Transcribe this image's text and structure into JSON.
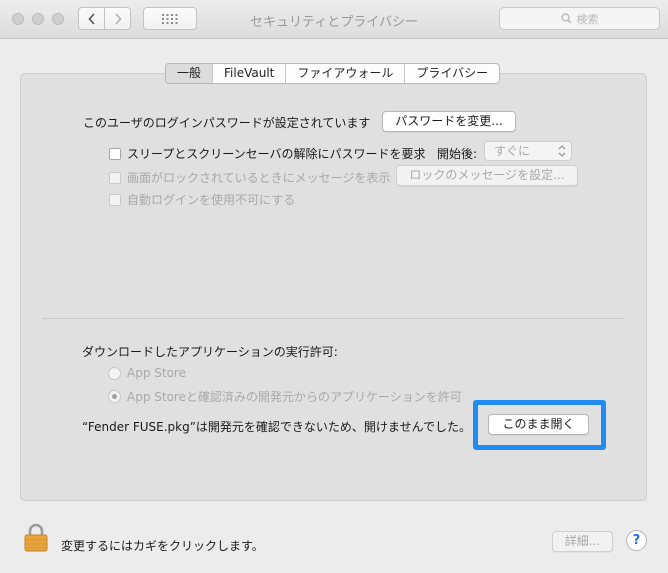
{
  "window": {
    "title": "セキュリティとプライバシー",
    "search_placeholder": "検索"
  },
  "tabs": [
    {
      "label": "一般",
      "selected": true
    },
    {
      "label": "FileVault",
      "selected": false
    },
    {
      "label": "ファイアウォール",
      "selected": false
    },
    {
      "label": "プライバシー",
      "selected": false
    }
  ],
  "general": {
    "password_set_text": "このユーザのログインパスワードが設定されています",
    "change_password_button": "パスワードを変更...",
    "require_password_label": "スリープとスクリーンセーバの解除にパスワードを要求",
    "require_password_checked": false,
    "after_label": "開始後:",
    "after_value": "すぐに",
    "show_message_label": "画面がロックされているときにメッセージを表示",
    "show_message_checked": false,
    "set_message_button": "ロックのメッセージを設定...",
    "disable_autologin_label": "自動ログインを使用不可にする",
    "disable_autologin_checked": false
  },
  "downloads": {
    "heading": "ダウンロードしたアプリケーションの実行許可:",
    "option_app_store": "App Store",
    "option_app_store_dev": "App Storeと確認済みの開発元からのアプリケーションを許可",
    "selected_option": "App Storeと確認済みの開発元からのアプリケーションを許可",
    "blocked_message": "“Fender FUSE.pkg”は開発元を確認できないため、開けませんでした。",
    "open_anyway_button": "このまま開く"
  },
  "footer": {
    "lock_text": "変更するにはカギをクリックします。",
    "advanced_button": "詳細...",
    "help_button": "?"
  },
  "colors": {
    "highlight": "#1e8cf0",
    "lock_body": "#e8a33a"
  }
}
